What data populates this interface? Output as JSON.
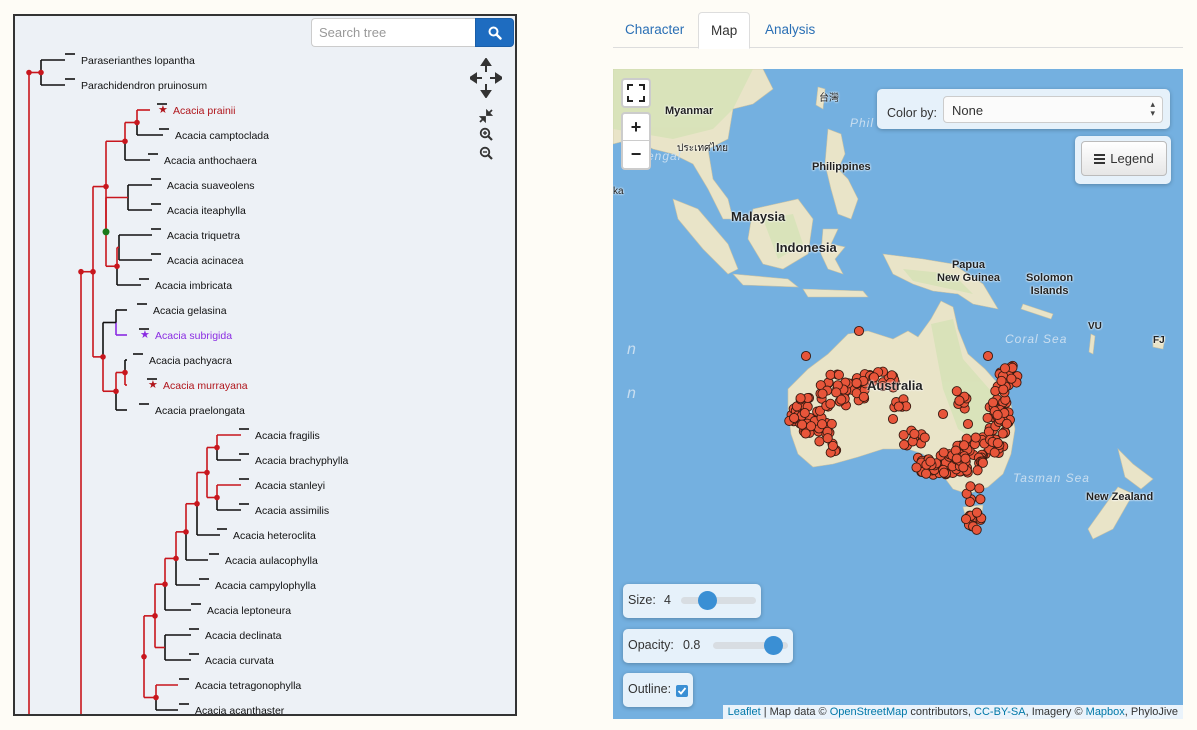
{
  "tree": {
    "search_placeholder": "Search tree",
    "leaves": [
      {
        "label": "Paraserianthes lopantha",
        "style": "normal"
      },
      {
        "label": "Parachidendron pruinosum",
        "style": "normal"
      },
      {
        "label": "Acacia prainii",
        "style": "red",
        "star": "red"
      },
      {
        "label": "Acacia camptoclada",
        "style": "normal"
      },
      {
        "label": "Acacia anthochaera",
        "style": "normal"
      },
      {
        "label": "Acacia suaveolens",
        "style": "normal"
      },
      {
        "label": "Acacia iteaphylla",
        "style": "normal"
      },
      {
        "label": "Acacia triquetra",
        "style": "normal"
      },
      {
        "label": "Acacia acinacea",
        "style": "normal"
      },
      {
        "label": "Acacia imbricata",
        "style": "normal"
      },
      {
        "label": "Acacia gelasina",
        "style": "normal"
      },
      {
        "label": "Acacia subrigida",
        "style": "purple",
        "star": "purple"
      },
      {
        "label": "Acacia pachyacra",
        "style": "normal"
      },
      {
        "label": "Acacia murrayana",
        "style": "red",
        "star": "red"
      },
      {
        "label": "Acacia praelongata",
        "style": "normal"
      },
      {
        "label": "Acacia fragilis",
        "style": "normal"
      },
      {
        "label": "Acacia brachyphylla",
        "style": "normal"
      },
      {
        "label": "Acacia stanleyi",
        "style": "normal"
      },
      {
        "label": "Acacia assimilis",
        "style": "normal"
      },
      {
        "label": "Acacia heteroclita",
        "style": "normal"
      },
      {
        "label": "Acacia aulacophylla",
        "style": "normal"
      },
      {
        "label": "Acacia campylophylla",
        "style": "normal"
      },
      {
        "label": "Acacia leptoneura",
        "style": "normal"
      },
      {
        "label": "Acacia declinata",
        "style": "normal"
      },
      {
        "label": "Acacia curvata",
        "style": "normal"
      },
      {
        "label": "Acacia tetragonophylla",
        "style": "normal"
      },
      {
        "label": "Acacia acanthaster",
        "style": "normal"
      }
    ],
    "icons": [
      "pan-arrows-icon",
      "collapse-icon",
      "zoom-in-icon",
      "zoom-out-icon"
    ]
  },
  "tabs": [
    {
      "label": "Character",
      "active": false
    },
    {
      "label": "Map",
      "active": true
    },
    {
      "label": "Analysis",
      "active": false
    }
  ],
  "map": {
    "color_by_label": "Color by:",
    "color_by_value": "None",
    "legend_label": "Legend",
    "zoom_in_label": "+",
    "zoom_out_label": "−",
    "size_label": "Size:",
    "size_value": "4",
    "size_fraction": 0.35,
    "opacity_label": "Opacity:",
    "opacity_value": "0.8",
    "opacity_fraction": 0.8,
    "outline_label": "Outline:",
    "outline_checked": true,
    "point_color": "#e8553a",
    "labels": {
      "myanmar": "Myanmar",
      "taiwan": "台灣",
      "thailand": "ประเทศไทย",
      "philippines": "Philippines",
      "malaysia": "Malaysia",
      "indonesia": "Indonesia",
      "png": "Papua\nNew Guinea",
      "solomon": "Solomon\nIslands",
      "vu": "VU",
      "fj": "FJ",
      "australia": "Australia",
      "coral_sea": "Coral Sea",
      "tasman_sea": "Tasman Sea",
      "new_zealand": "New Zealand",
      "phil_sea": "Phil",
      "bengal": "engal",
      "ka": "ka",
      "ocean1": "n",
      "ocean2": "n"
    },
    "attribution": {
      "leaflet": "Leaflet",
      "sep": " | Map data © ",
      "osm": "OpenStreetMap",
      "contrib": " contributors, ",
      "license": "CC-BY-SA",
      "imagery": ", Imagery © ",
      "mapbox": "Mapbox",
      "phylojive": ", PhyloJive"
    }
  }
}
